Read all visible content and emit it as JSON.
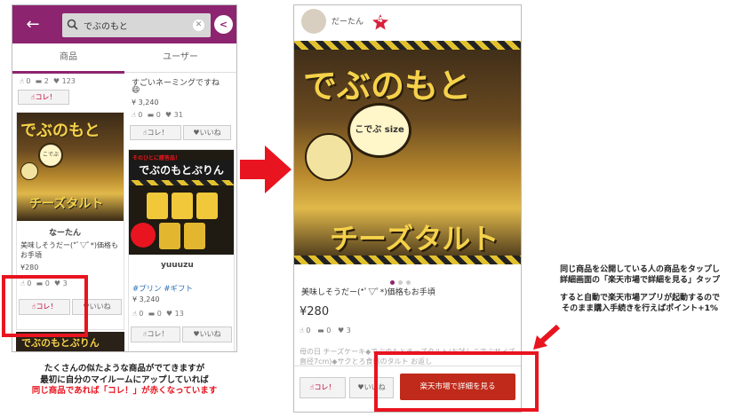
{
  "left_phone": {
    "search_query": "でぶのもと",
    "tabs": [
      {
        "label": "商品",
        "active": true
      },
      {
        "label": "ユーザー",
        "active": false
      }
    ],
    "top_left_stats": {
      "kore": "0",
      "comments": "2",
      "likes": "123"
    },
    "top_left_kore_label": "コレ！",
    "top_right_title": "すごいネーミングですね",
    "top_right_emoji": "😄",
    "top_right_price": "¥ 3,240",
    "top_right_stats": {
      "kore": "0",
      "comments": "0",
      "likes": "31"
    },
    "cards": [
      {
        "image_title_top": "でぶのもと",
        "image_badge": "こでぶ",
        "image_title_bottom": "チーズタルト",
        "user": "なーたん",
        "title": "美味しそうだー(*ﾟ▽ﾟ*)価格もお手頃",
        "price": "¥280",
        "stats": {
          "kore": "0",
          "comments": "0",
          "likes": "3"
        },
        "kore_label": "コレ！",
        "like_label": "いいね"
      },
      {
        "image_banner": "そのひとに贈答品！",
        "image_title": "でぶのもとぷりん",
        "user": "yuuuzu",
        "tags": "#プリン #ギフト",
        "price": "¥ 3,240",
        "stats": {
          "kore": "0",
          "comments": "0",
          "likes": "13"
        },
        "kore_label": "コレ！",
        "like_label": "いいね"
      }
    ],
    "mid_right_kore_label": "コレ！",
    "mid_right_like_label": "いいね",
    "bottom_card_title": "でぶのもとぷりん"
  },
  "right_phone": {
    "user_name": "だーたん",
    "user_badge": "4",
    "hero_title_top": "でぶのもと",
    "hero_badge": "こでぶ size",
    "hero_title_bottom": "チーズタルト",
    "description": "美味しそうだー(*ﾟ▽ﾟ*)価格もお手頃",
    "price": "¥280",
    "stats": {
      "kore": "0",
      "comments": "0",
      "likes": "3"
    },
    "body_text": "母の日 チーズケーキ◆でぶのもとチーズタルト(お試しこでぶサイズ直径7cm)◆サクとろ食感のタルト お返し",
    "kore_label": "コレ！",
    "like_label": "いいね",
    "rakuten_button": "楽天市場で詳細を見る"
  },
  "captions": {
    "left_line1": "たくさんの似たような商品がでてきますが",
    "left_line2": "最初に自分のマイルームにアップしていれば",
    "left_line3_red": "同じ商品であれば「コレ！」が赤くなっています",
    "right_line1": "同じ商品を公開している人の商品をタップし",
    "right_line2": "詳細画面の「楽天市場で詳細を見る」タップ",
    "right_line3": "すると自動で楽天市場アプリが起動するので",
    "right_line4": "そのまま購入手続きを行えばポイント+1%"
  },
  "colors": {
    "brand_purple": "#8d2470",
    "highlight_red": "#e8141f",
    "rakuten_red": "#bf2a1a"
  },
  "icons": [
    "back-arrow-icon",
    "search-icon",
    "clear-icon",
    "share-icon",
    "hand-icon",
    "comment-icon",
    "heart-icon",
    "star-badge-icon",
    "big-red-arrow-icon",
    "small-red-arrow-icon"
  ]
}
